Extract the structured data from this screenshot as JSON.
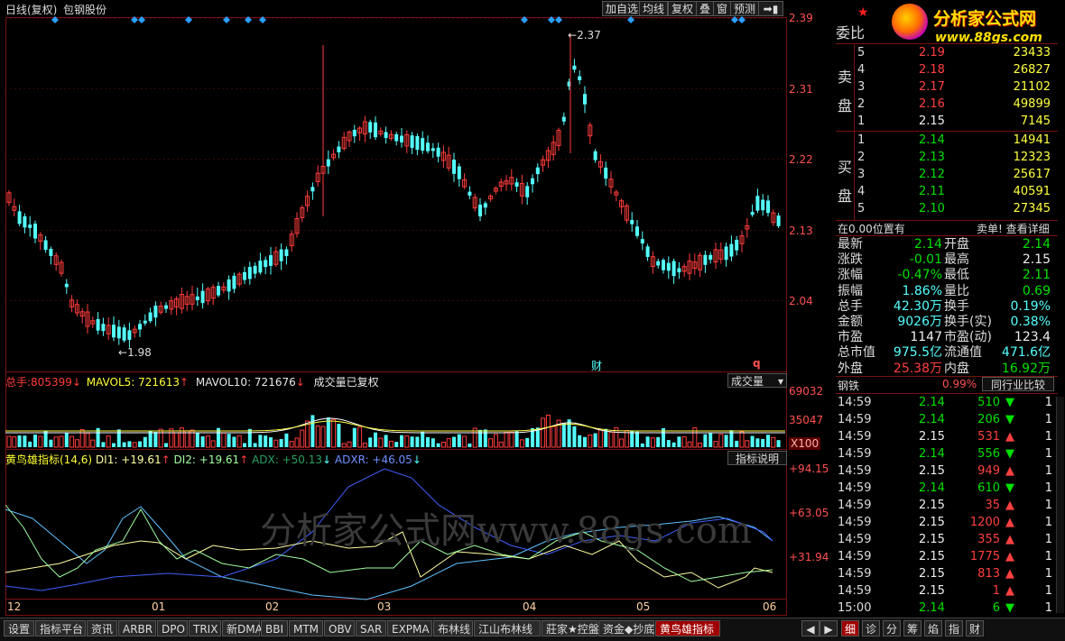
{
  "chart_header": {
    "period": "日线(复权)",
    "stock_name": "包钢股份"
  },
  "toolbar": [
    "加自选",
    "均线",
    "复权",
    "叠",
    "窗",
    "预测"
  ],
  "price_axis": [
    "2.39",
    "2.31",
    "2.22",
    "2.13",
    "2.04"
  ],
  "price_annotations": {
    "high": "2.37",
    "low": "1.98"
  },
  "month_labels": [
    "12",
    "01",
    "02",
    "03",
    "04",
    "05",
    "06"
  ],
  "markers": {
    "cai": "财",
    "q": "q"
  },
  "volume_header": {
    "total_label": "总手:",
    "total_value": "805399",
    "total_arrow": "↓",
    "mavol5": "MAVOL5: 721613",
    "mavol5_arrow": "↑",
    "mavol10": "MAVOL10: 721676",
    "mavol10_arrow": "↓",
    "note": "成交量已复权",
    "dropdown": "成交量"
  },
  "volume_axis": [
    "69032",
    "35047",
    "X100"
  ],
  "indicator_header": {
    "name": "黄鸟雄指标(14,6)",
    "di1": "DI1: +19.61",
    "di2": "DI2: +19.61",
    "adx": "ADX: +50.13",
    "adxr": "ADXR: +46.05",
    "help": "指标说明"
  },
  "indicator_axis": [
    "+94.15",
    "+63.05",
    "+31.94"
  ],
  "watermark": "分析家公式网www.88gs.com",
  "logo": {
    "title": "分析家公式网",
    "url": "www.88gs.com"
  },
  "order_book": {
    "label_wei": "委比",
    "sell_label": [
      "卖",
      "盘"
    ],
    "buy_label": [
      "买",
      "盘"
    ],
    "sell": [
      {
        "level": "5",
        "price": "2.19",
        "vol": "23433"
      },
      {
        "level": "4",
        "price": "2.18",
        "vol": "26827"
      },
      {
        "level": "3",
        "price": "2.17",
        "vol": "21102"
      },
      {
        "level": "2",
        "price": "2.16",
        "vol": "49899"
      },
      {
        "level": "1",
        "price": "2.15",
        "vol": "7145"
      }
    ],
    "buy": [
      {
        "level": "1",
        "price": "2.14",
        "vol": "14941"
      },
      {
        "level": "2",
        "price": "2.13",
        "vol": "12323"
      },
      {
        "level": "3",
        "price": "2.12",
        "vol": "25617"
      },
      {
        "level": "4",
        "price": "2.11",
        "vol": "40591"
      },
      {
        "level": "5",
        "price": "2.10",
        "vol": "27345"
      }
    ]
  },
  "position_bar": {
    "left": "在0.00位置有",
    "right": "卖单! 查看详细"
  },
  "quote_stats": [
    {
      "l1": "最新",
      "v1": "2.14",
      "c1": "grn",
      "l2": "开盘",
      "v2": "2.14",
      "c2": "grn"
    },
    {
      "l1": "涨跌",
      "v1": "-0.01",
      "c1": "grn",
      "l2": "最高",
      "v2": "2.15",
      "c2": "wht"
    },
    {
      "l1": "涨幅",
      "v1": "-0.47%",
      "c1": "grn",
      "l2": "最低",
      "v2": "2.11",
      "c2": "grn"
    },
    {
      "l1": "振幅",
      "v1": "1.86%",
      "c1": "cyan",
      "l2": "量比",
      "v2": "0.69",
      "c2": "grn"
    },
    {
      "l1": "总手",
      "v1": "42.30万",
      "c1": "cyan",
      "l2": "换手",
      "v2": "0.19%",
      "c2": "cyan"
    },
    {
      "l1": "金额",
      "v1": "9026万",
      "c1": "cyan",
      "l2": "换手(实)",
      "v2": "0.38%",
      "c2": "cyan"
    },
    {
      "l1": "市盈",
      "v1": "1147",
      "c1": "wht",
      "l2": "市盈(动)",
      "v2": "123.4",
      "c2": "wht"
    },
    {
      "l1": "总市值",
      "v1": "975.5亿",
      "c1": "cyan",
      "l2": "流通值",
      "v2": "471.6亿",
      "c2": "cyan"
    },
    {
      "l1": "外盘",
      "v1": "25.38万",
      "c1": "red",
      "l2": "内盘",
      "v2": "16.92万",
      "c2": "grn"
    }
  ],
  "sector": {
    "name": "钢铁",
    "pct": "0.99%",
    "button": "同行业比较"
  },
  "ticks": [
    {
      "t": "14:59",
      "p": "2.14",
      "pc": "grn",
      "v": "510",
      "d": "down",
      "n": "1"
    },
    {
      "t": "14:59",
      "p": "2.14",
      "pc": "grn",
      "v": "206",
      "d": "down",
      "n": "1"
    },
    {
      "t": "14:59",
      "p": "2.15",
      "pc": "wht",
      "v": "531",
      "d": "up",
      "n": "1"
    },
    {
      "t": "14:59",
      "p": "2.14",
      "pc": "grn",
      "v": "556",
      "d": "down",
      "n": "1"
    },
    {
      "t": "14:59",
      "p": "2.15",
      "pc": "wht",
      "v": "949",
      "d": "up",
      "n": "1"
    },
    {
      "t": "14:59",
      "p": "2.14",
      "pc": "grn",
      "v": "610",
      "d": "down",
      "n": "1"
    },
    {
      "t": "14:59",
      "p": "2.15",
      "pc": "wht",
      "v": "35",
      "d": "up",
      "n": "1"
    },
    {
      "t": "14:59",
      "p": "2.15",
      "pc": "wht",
      "v": "1200",
      "d": "up",
      "n": "1"
    },
    {
      "t": "14:59",
      "p": "2.15",
      "pc": "wht",
      "v": "355",
      "d": "up",
      "n": "1"
    },
    {
      "t": "14:59",
      "p": "2.15",
      "pc": "wht",
      "v": "1775",
      "d": "up",
      "n": "1"
    },
    {
      "t": "14:59",
      "p": "2.15",
      "pc": "wht",
      "v": "813",
      "d": "up",
      "n": "1"
    },
    {
      "t": "14:59",
      "p": "2.15",
      "pc": "wht",
      "v": "1",
      "d": "up",
      "n": "1"
    },
    {
      "t": "15:00",
      "p": "2.14",
      "pc": "grn",
      "v": "6",
      "d": "down",
      "n": "1"
    }
  ],
  "bottom_tabs": [
    "设置",
    "指标平台",
    "资讯",
    "ARBR",
    "DPO",
    "TRIX",
    "新DMA",
    "BBI",
    "MTM",
    "OBV",
    "SAR",
    "EXPMA",
    "布林线",
    "江山布林线",
    "莊家★控盤",
    "资金◆抄底",
    "黄鸟雄指标"
  ],
  "right_tabs": [
    "细",
    "诊",
    "分",
    "筹",
    "焰",
    "指",
    "财"
  ],
  "colors": {
    "up": "#ff3c3c",
    "down": "#54ffff",
    "grid": "#7a1010",
    "di1": "#ffffa0",
    "di2": "#a0ffa0",
    "adx": "#4060ff",
    "adxr": "#60c0ff"
  }
}
